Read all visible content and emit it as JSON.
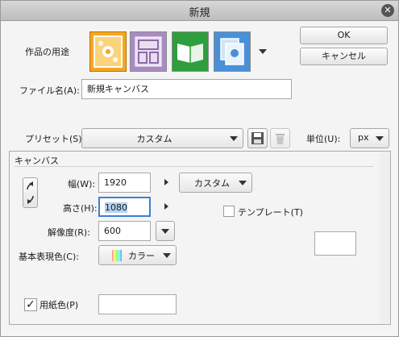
{
  "dialog": {
    "title": "新規",
    "ok_label": "OK",
    "cancel_label": "キャンセル"
  },
  "usage": {
    "label": "作品の用途",
    "icons": [
      "illustration-icon",
      "comic-icon",
      "webtoon-icon",
      "animation-icon"
    ],
    "selected_index": 0
  },
  "filename": {
    "label": "ファイル名(A):",
    "value": "新規キャンバス"
  },
  "preset": {
    "label": "プリセット(S):",
    "value": "カスタム"
  },
  "unit": {
    "label": "単位(U):",
    "value": "px"
  },
  "canvas": {
    "group_label": "キャンバス",
    "width_label": "幅(W):",
    "width_value": "1920",
    "height_label": "高さ(H):",
    "height_value": "1080",
    "size_preset": "カスタム",
    "resolution_label": "解像度(R):",
    "resolution_value": "600",
    "color_label": "基本表現色(C):",
    "color_value": "カラー",
    "template_label": "テンプレート(T)",
    "template_checked": false,
    "paper_label": "用紙色(P)",
    "paper_checked": true,
    "paper_color": "#ffffff"
  },
  "colors": {
    "selected_usage": "#f5a623",
    "accent_green": "#2e9e3e",
    "comic_purple": "#8e6aa8"
  }
}
